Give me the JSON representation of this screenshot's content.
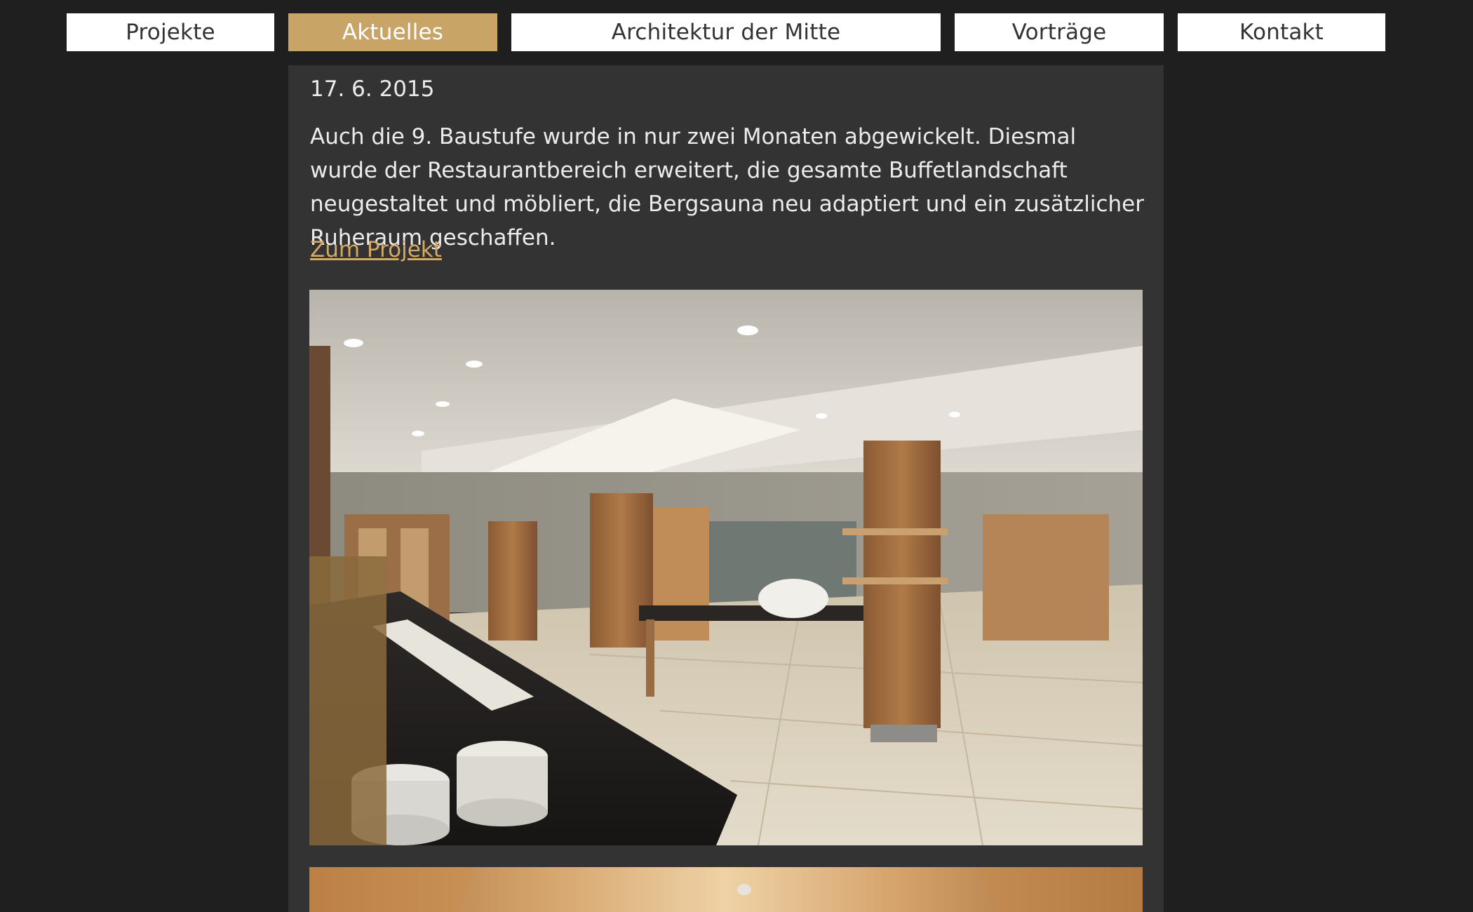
{
  "nav": {
    "tabs": [
      {
        "label": "Projekte",
        "active": false
      },
      {
        "label": "Aktuelles",
        "active": true
      },
      {
        "label": "Architektur der Mitte",
        "active": false
      },
      {
        "label": "Vorträge",
        "active": false
      },
      {
        "label": "Kontakt",
        "active": false
      }
    ]
  },
  "post": {
    "date": "17. 6. 2015",
    "body": "Auch die 9. Baustufe wurde in nur zwei Monaten abgewickelt. Diesmal wurde der Restaurantbereich erweitert, die gesamte Buffetlandschaft neugestaltet und möbliert, die Bergsauna neu adaptiert und ein zusätzlicher Ruheraum geschaffen.",
    "link_label": "Zum Projekt"
  },
  "images": [
    {
      "name": "restaurant-buffet-photo"
    },
    {
      "name": "wooden-ceiling-photo"
    }
  ],
  "colors": {
    "page_background": "#1f1f1f",
    "panel_background": "#333333",
    "accent": "#c9a467",
    "link": "#d3a964",
    "text": "#ececec"
  }
}
